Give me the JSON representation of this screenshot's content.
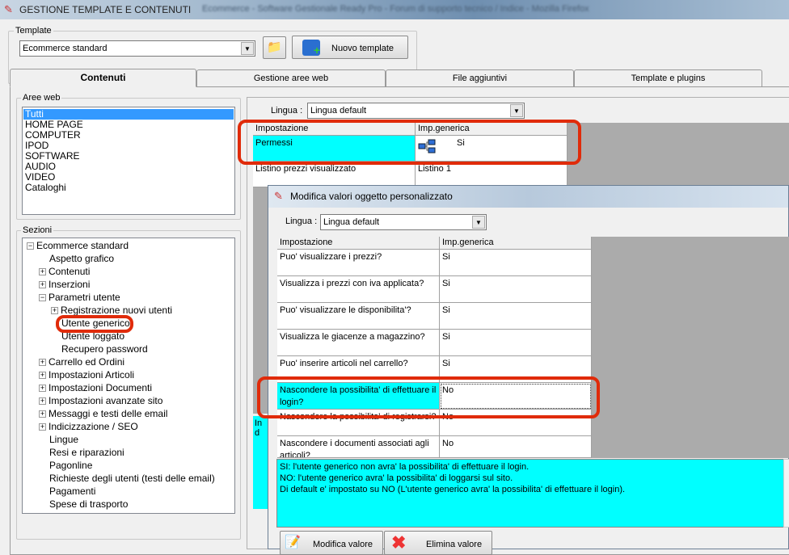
{
  "window": {
    "title": "GESTIONE TEMPLATE E CONTENUTI",
    "background_title": "Ecommerce - Software Gestionale Ready Pro - Forum di supporto tecnico / Indice - Mozilla Firefox"
  },
  "template": {
    "group_label": "Template",
    "selected": "Ecommerce standard",
    "new_button": "Nuovo template"
  },
  "tabs": [
    {
      "label": "Contenuti",
      "active": true
    },
    {
      "label": "Gestione aree web"
    },
    {
      "label": "File aggiuntivi"
    },
    {
      "label": "Template e plugins"
    }
  ],
  "aree_web": {
    "label": "Aree web",
    "items": [
      "Tutti",
      "HOME PAGE",
      "COMPUTER",
      "IPOD",
      "SOFTWARE",
      "AUDIO",
      "VIDEO",
      "Cataloghi"
    ],
    "selected": "Tutti"
  },
  "sezioni": {
    "label": "Sezioni",
    "items": [
      {
        "label": "Ecommerce standard",
        "level": 0,
        "exp": "-"
      },
      {
        "label": "Aspetto grafico",
        "level": 1,
        "exp": ""
      },
      {
        "label": "Contenuti",
        "level": 1,
        "exp": "+"
      },
      {
        "label": "Inserzioni",
        "level": 1,
        "exp": "+"
      },
      {
        "label": "Parametri utente",
        "level": 1,
        "exp": "-"
      },
      {
        "label": "Registrazione nuovi utenti",
        "level": 2,
        "exp": "+"
      },
      {
        "label": "Utente generico",
        "level": 2,
        "exp": "",
        "highlight": true
      },
      {
        "label": "Utente loggato",
        "level": 2,
        "exp": ""
      },
      {
        "label": "Recupero password",
        "level": 2,
        "exp": ""
      },
      {
        "label": "Carrello ed Ordini",
        "level": 1,
        "exp": "+"
      },
      {
        "label": "Impostazioni Articoli",
        "level": 1,
        "exp": "+"
      },
      {
        "label": "Impostazioni Documenti",
        "level": 1,
        "exp": "+"
      },
      {
        "label": "Impostazioni avanzate sito",
        "level": 1,
        "exp": "+"
      },
      {
        "label": "Messaggi e testi delle email",
        "level": 1,
        "exp": "+"
      },
      {
        "label": "Indicizzazione / SEO",
        "level": 1,
        "exp": "+"
      },
      {
        "label": "Lingue",
        "level": 1,
        "exp": ""
      },
      {
        "label": "Resi e riparazioni",
        "level": 1,
        "exp": ""
      },
      {
        "label": "Pagonline",
        "level": 1,
        "exp": ""
      },
      {
        "label": "Richieste degli utenti (testi delle email)",
        "level": 1,
        "exp": ""
      },
      {
        "label": "Pagamenti",
        "level": 1,
        "exp": ""
      },
      {
        "label": "Spese di trasporto",
        "level": 1,
        "exp": ""
      }
    ]
  },
  "main": {
    "lingua_label": "Lingua :",
    "lingua_value": "Lingua default",
    "col1": "Impostazione",
    "col2": "Imp.generica",
    "rows": [
      {
        "name": "Permessi",
        "value": "Si",
        "icon": "hierarchy-icon"
      },
      {
        "name": "Listino prezzi visualizzato",
        "value": "Listino 1"
      }
    ],
    "partial_text": "In d"
  },
  "dialog": {
    "title": "Modifica valori oggetto personalizzato",
    "lingua_label": "Lingua :",
    "lingua_value": "Lingua default",
    "col1": "Impostazione",
    "col2": "Imp.generica",
    "rows": [
      {
        "name": "Puo' visualizzare i prezzi?",
        "value": "Si"
      },
      {
        "name": "Visualizza i prezzi con iva applicata?",
        "value": "Si"
      },
      {
        "name": "Puo' visualizzare le disponibilita'?",
        "value": "Si"
      },
      {
        "name": "Visualizza le giacenze a magazzino?",
        "value": "Si"
      },
      {
        "name": "Puo' inserire articoli nel carrello?",
        "value": "Si"
      },
      {
        "name": "Nascondere la possibilita' di effettuare il login?",
        "value": "No",
        "selected": true
      },
      {
        "name": "Nascondere la possibilita' di registrarsi?",
        "value": "No"
      },
      {
        "name": "Nascondere i documenti associati agli articoli?",
        "value": "No"
      }
    ],
    "description": [
      "SI: l'utente generico non avra' la possibilita' di effettuare il login.",
      "NO: l'utente  generico avra' la possibilita' di loggarsi sul sito.",
      "Di default e' impostato su NO (L'utente  generico avra' la possibilita' di effettuare il login)."
    ],
    "modify_button": "Modifica valore",
    "delete_button": "Elimina valore"
  },
  "colors": {
    "selection": "#00ffff",
    "highlight": "#e02b0a",
    "list_selection": "#3399ff"
  }
}
